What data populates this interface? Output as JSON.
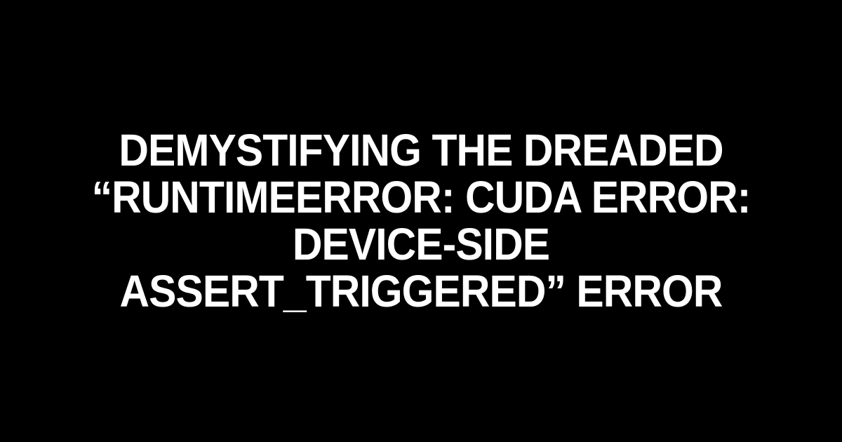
{
  "title": "DEMYSTIFYING THE DREADED “RUNTIMEERROR: CUDA ERROR: DEVICE-SIDE ASSERT_TRIGGERED” ERROR"
}
